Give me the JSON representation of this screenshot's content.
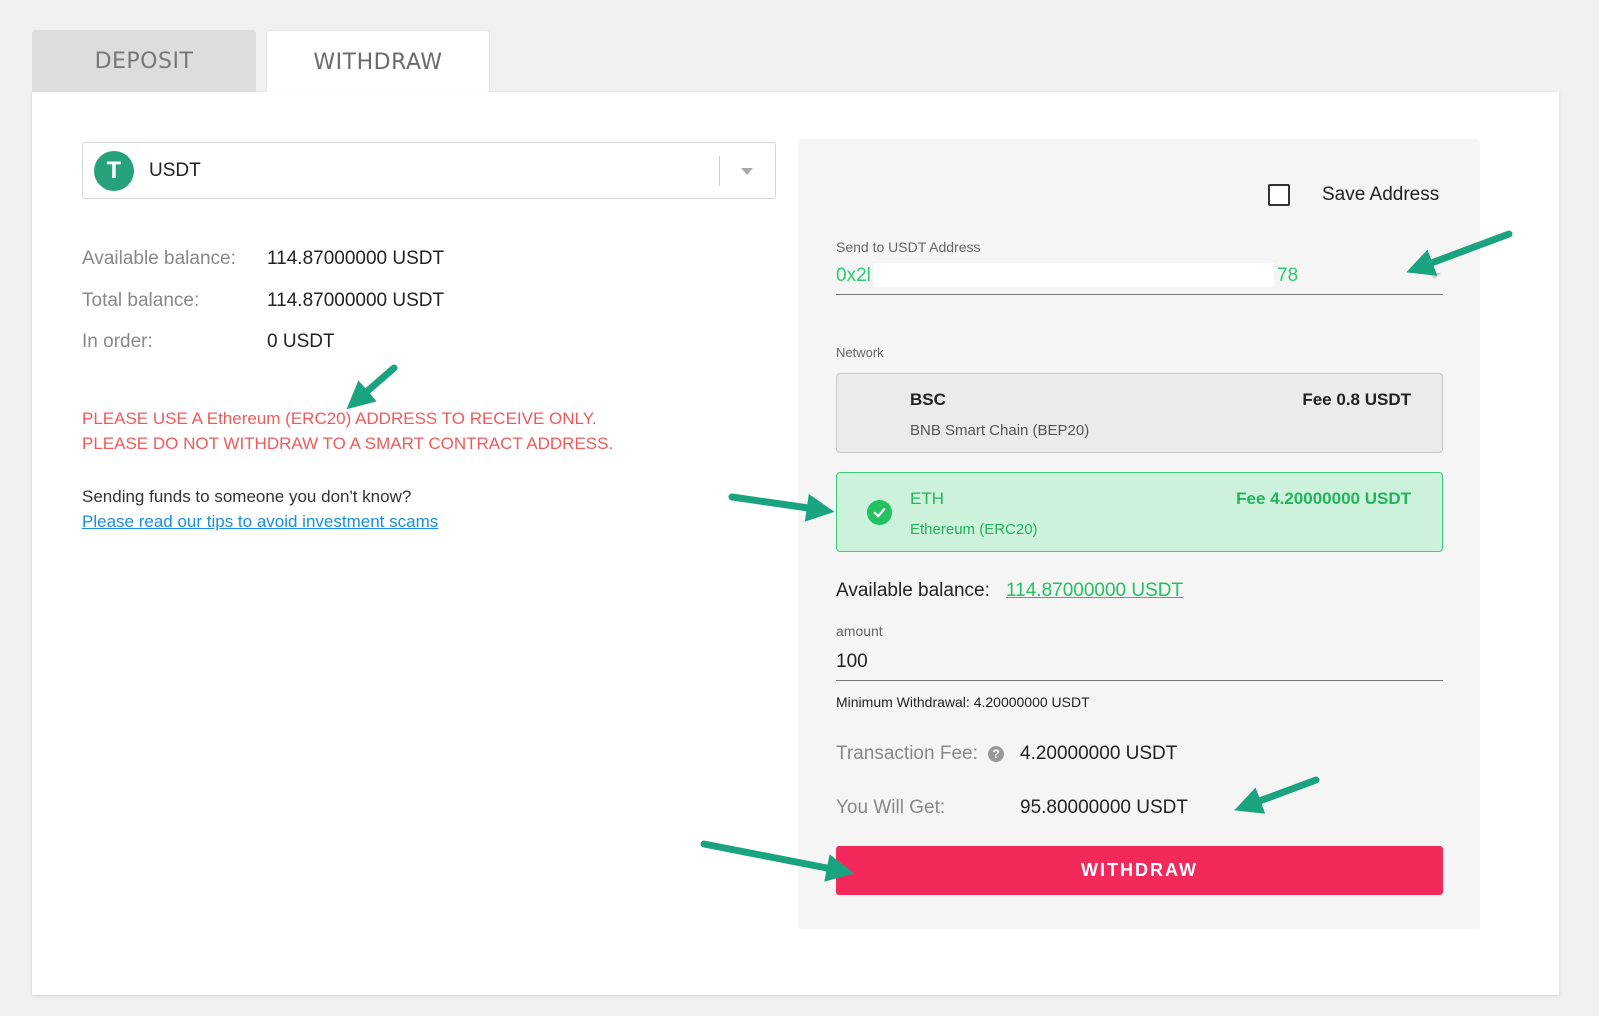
{
  "tabs": [
    {
      "label": "DEPOSIT",
      "active": false
    },
    {
      "label": "WITHDRAW",
      "active": true
    }
  ],
  "coin": {
    "symbol_glyph": "T",
    "name": "USDT",
    "icon": "tether-icon"
  },
  "balances": [
    {
      "label": "Available balance:",
      "value": "114.87000000 USDT"
    },
    {
      "label": "Total balance:",
      "value": "114.87000000 USDT"
    },
    {
      "label": "In order:",
      "value": "0 USDT"
    }
  ],
  "warnings": [
    "PLEASE USE A Ethereum (ERC20) ADDRESS TO RECEIVE ONLY.",
    "PLEASE DO NOT WITHDRAW TO A SMART CONTRACT ADDRESS."
  ],
  "scam": {
    "question": "Sending funds to someone you don't know?",
    "link": "Please read our tips to avoid investment scams"
  },
  "form": {
    "save_address_label": "Save Address",
    "address_label": "Send to USDT Address",
    "address_start": "0x2l",
    "address_end": "78",
    "network_label": "Network",
    "networks": [
      {
        "code": "BSC",
        "name": "BNB Smart Chain (BEP20)",
        "fee": "Fee 0.8 USDT",
        "selected": false
      },
      {
        "code": "ETH",
        "name": "Ethereum (ERC20)",
        "fee": "Fee 4.20000000 USDT",
        "selected": true
      }
    ],
    "available_label": "Available balance:",
    "available_value": "114.87000000 USDT",
    "amount_label": "amount",
    "amount_value": "100",
    "min_withdrawal": "Minimum Withdrawal: 4.20000000 USDT",
    "fee_label": "Transaction Fee:",
    "fee_value": "4.20000000 USDT",
    "get_label": "You Will Get:",
    "get_value": "95.80000000 USDT",
    "submit_label": "WITHDRAW"
  },
  "colors": {
    "accent_green": "#22c261",
    "warning_red": "#f05a5a",
    "button_red": "#f2295a",
    "annotation_arrow": "#1aa37f"
  }
}
